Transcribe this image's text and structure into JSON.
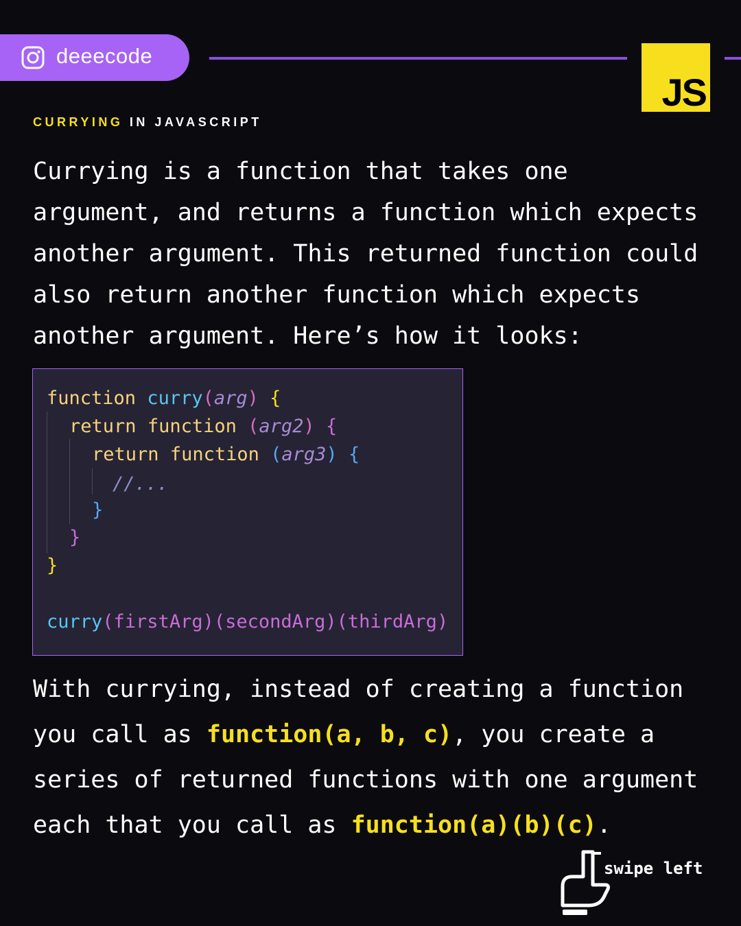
{
  "header": {
    "handle": "deeecode",
    "logo_text": "JS",
    "subtitle_highlight": "CURRYING",
    "subtitle_rest": " IN JAVASCRIPT"
  },
  "intro_lines": [
    "Currying is a function that takes one",
    "argument, and returns a function which expects",
    "another argument. This returned function could",
    "also return another function which expects",
    "another argument. Here’s how it looks:"
  ],
  "code": {
    "l1": {
      "kw": "function",
      "name": "curry",
      "open": "(",
      "param": "arg",
      "close": ")",
      "brace": "{"
    },
    "l2": {
      "kw": "return",
      "kw2": "function",
      "open": "(",
      "param": "arg2",
      "close": ")",
      "brace": "{"
    },
    "l3": {
      "kw": "return",
      "kw2": "function",
      "open": "(",
      "param": "arg3",
      "close": ")",
      "brace": "{"
    },
    "l4": {
      "comment": "//..."
    },
    "l5": "}",
    "l6": "}",
    "l7": "}",
    "call": {
      "name": "curry",
      "args": "(firstArg)(secondArg)(thirdArg)"
    }
  },
  "outro": {
    "line1": "With currying, instead of creating a function",
    "line2_pre": "you call as ",
    "line2_code": "function(a, b, c)",
    "line2_post": ", you create a",
    "line3": "series of returned functions with one argument",
    "line4_pre": "each that you call as ",
    "line4_code": "function(a)(b)(c)",
    "line4_post": "."
  },
  "swipe": {
    "label": "swipe left",
    "icon": "hand-swipe-icon"
  },
  "colors": {
    "accent": "#a663f5",
    "js_yellow": "#f7df1e",
    "background": "#0b0b0f",
    "code_bg": "#262335"
  }
}
